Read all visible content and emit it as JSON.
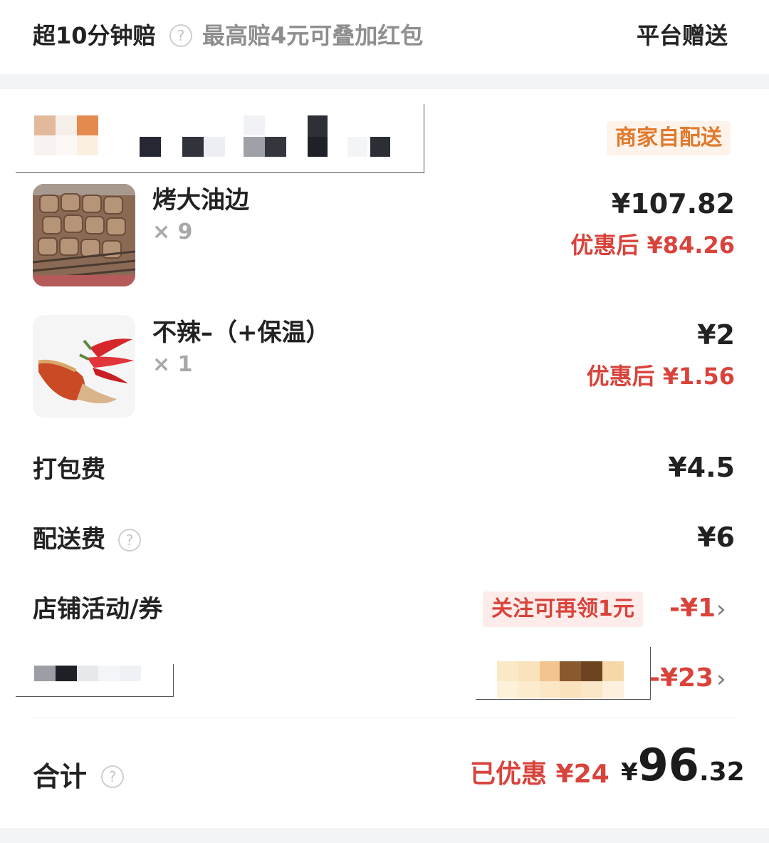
{
  "compensation": {
    "title": "超10分钟赔",
    "subtitle": "最高赔4元可叠加红包",
    "right_label": "平台赠送"
  },
  "store": {
    "delivery_badge": "商家自配送"
  },
  "items": [
    {
      "name": "烤大油边",
      "qty": "× 9",
      "price": "¥107.82",
      "discounted_price": "优惠后 ¥84.26",
      "image_icon": "grilled-skewers-photo"
    },
    {
      "name": "不辣–（+保温）",
      "qty": "× 1",
      "price": "¥2",
      "discounted_price": "优惠后 ¥1.56",
      "image_icon": "chili-powder-photo"
    }
  ],
  "fees": {
    "packing_label": "打包费",
    "packing_value": "¥4.5",
    "delivery_label": "配送费",
    "delivery_value": "¥6"
  },
  "promo": {
    "label": "店铺活动/券",
    "badge": "关注可再领1元",
    "value": "-¥1"
  },
  "red_packet": {
    "value": "-¥23"
  },
  "total": {
    "label": "合计",
    "saved": "已优惠 ¥24",
    "currency": "¥",
    "amount_int": "96",
    "amount_dec": ".32"
  },
  "colors": {
    "accent_red": "#d8433b",
    "badge_orange": "#e07a2e",
    "badge_bg": "#fdf3ea",
    "promo_badge_bg": "#fdecea"
  }
}
